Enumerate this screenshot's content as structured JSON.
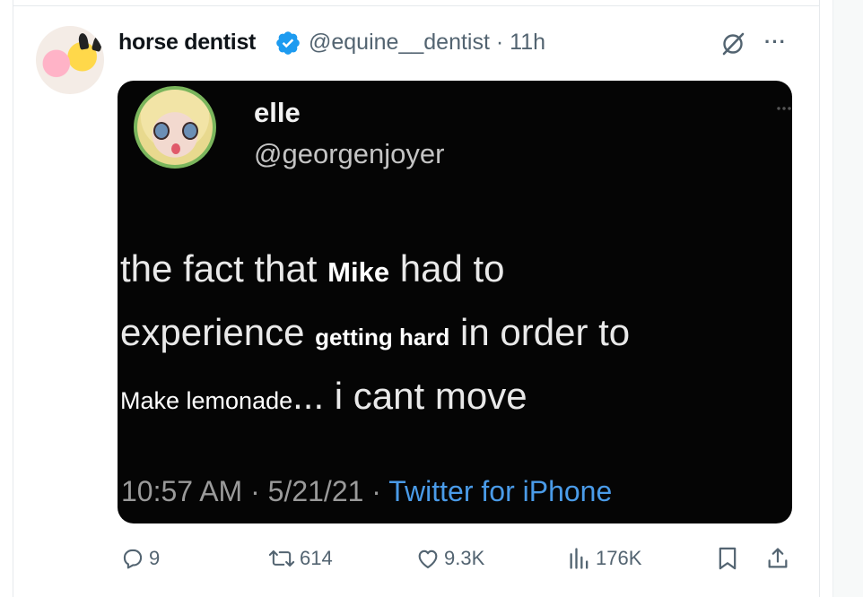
{
  "tweet": {
    "author_name": "horse dentist",
    "author_handle": "@equine__dentist",
    "separator": "·",
    "time": "11h",
    "more_label": "···"
  },
  "embedded": {
    "name": "elle",
    "handle": "@georgenjoyer",
    "line1": {
      "a": "the fact that ",
      "pasted": "Mike",
      "b": " had to"
    },
    "line2": {
      "a": "experience ",
      "pasted": "getting hard",
      "b": " in order to"
    },
    "line3": {
      "pasted": "Make lemonade",
      "b": "... i cant move"
    },
    "meta": "10:57 AM · 5/21/21 · ",
    "source": "Twitter for iPhone"
  },
  "actions": {
    "replies": "9",
    "retweets": "614",
    "likes": "9.3K",
    "views": "176K"
  },
  "colors": {
    "verified": "#1d9bf0",
    "muted": "#536471",
    "inner_ring": "#7ab55c",
    "inner_link": "#4a9be8"
  },
  "icons": [
    "verified-badge-icon",
    "grok-icon",
    "more-icon",
    "reply-icon",
    "retweet-icon",
    "like-icon",
    "views-icon",
    "bookmark-icon",
    "share-icon"
  ]
}
